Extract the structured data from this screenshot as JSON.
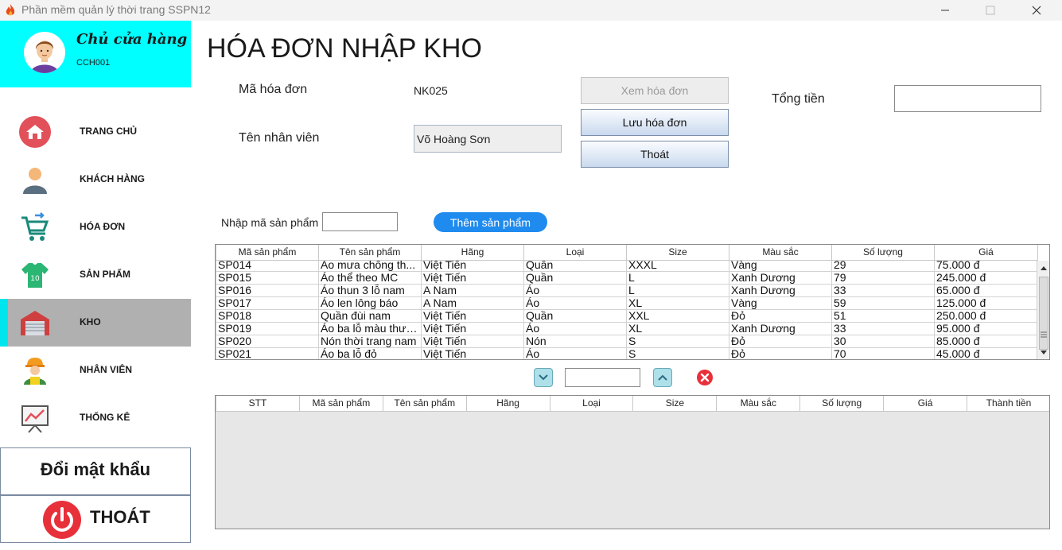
{
  "window": {
    "title": "Phần mềm quản lý thời trang SSPN12",
    "controls": {
      "minimize": "—",
      "maximize": "☐",
      "close": "✕"
    }
  },
  "user": {
    "role": "Chủ cửa hàng",
    "id": "CCH001"
  },
  "nav": [
    {
      "label": "TRANG CHỦ",
      "icon": "home-icon"
    },
    {
      "label": "KHÁCH HÀNG",
      "icon": "customer-icon"
    },
    {
      "label": "HÓA ĐƠN",
      "icon": "cart-icon"
    },
    {
      "label": "SẢN PHẨM",
      "icon": "shirt-icon"
    },
    {
      "label": "KHO",
      "icon": "warehouse-icon",
      "active": true
    },
    {
      "label": "NHÂN VIÊN",
      "icon": "worker-icon"
    },
    {
      "label": "THỐNG KÊ",
      "icon": "chart-board-icon"
    }
  ],
  "side_buttons": {
    "change_password": "Đổi mật khẩu",
    "logout": "THOÁT"
  },
  "page": {
    "title": "HÓA ĐƠN NHẬP KHO",
    "invoice_label": "Mã hóa đơn",
    "invoice_value": "NK025",
    "staff_label": "Tên nhân viên",
    "staff_value": "Võ Hoàng Sơn",
    "total_label": "Tổng tiền",
    "total_value": "",
    "buttons": {
      "view": "Xem hóa đơn",
      "save": "Lưu hóa đơn",
      "exit": "Thoát"
    },
    "product_code_label": "Nhập mã sản phẩm",
    "product_code_value": "",
    "add_product": "Thêm sản phẩm",
    "quantity_value": ""
  },
  "product_table": {
    "columns": [
      "Mã sản phẩm",
      "Tên sản phẩm",
      "Hãng",
      "Loại",
      "Size",
      "Màu sắc",
      "Số lượng",
      "Giá"
    ],
    "rows": [
      [
        "SP014",
        "Áo mưa chống th...",
        "Việt Tiến",
        "Quần",
        "XXXL",
        "Vàng",
        "29",
        "75.000 đ"
      ],
      [
        "SP015",
        "Áo thể theo MC",
        "Việt Tiến",
        "Quần",
        "L",
        "Xanh Dương",
        "79",
        "245.000 đ"
      ],
      [
        "SP016",
        "Áo thun 3 lỗ nam",
        "A Nam",
        "Áo",
        "L",
        "Xanh Dương",
        "33",
        "65.000 đ"
      ],
      [
        "SP017",
        "Áo len lông báo",
        "A Nam",
        "Áo",
        "XL",
        "Vàng",
        "59",
        "125.000 đ"
      ],
      [
        "SP018",
        "Quần đùi nam",
        "Việt Tiến",
        "Quần",
        "XXL",
        "Đỏ",
        "51",
        "250.000 đ"
      ],
      [
        "SP019",
        "Áo ba lỗ màu thườ...",
        "Việt Tiến",
        "Áo",
        "XL",
        "Xanh Dương",
        "33",
        "95.000 đ"
      ],
      [
        "SP020",
        "Nón thời trang nam",
        "Việt Tiến",
        "Nón",
        "S",
        "Đỏ",
        "30",
        "85.000 đ"
      ],
      [
        "SP021",
        "Áo ba lỗ đỏ",
        "Việt Tiến",
        "Áo",
        "S",
        "Đỏ",
        "70",
        "45.000 đ"
      ]
    ]
  },
  "cart_table": {
    "columns": [
      "STT",
      "Mã sản phẩm",
      "Tên sản phẩm",
      "Hãng",
      "Loại",
      "Size",
      "Màu sắc",
      "Số lượng",
      "Giá",
      "Thành tiền"
    ],
    "rows": []
  },
  "colors": {
    "accent": "#00ffff",
    "active_nav": "#b0b0b0",
    "primary_button": "#1f8bef",
    "danger": "#e8303a"
  }
}
